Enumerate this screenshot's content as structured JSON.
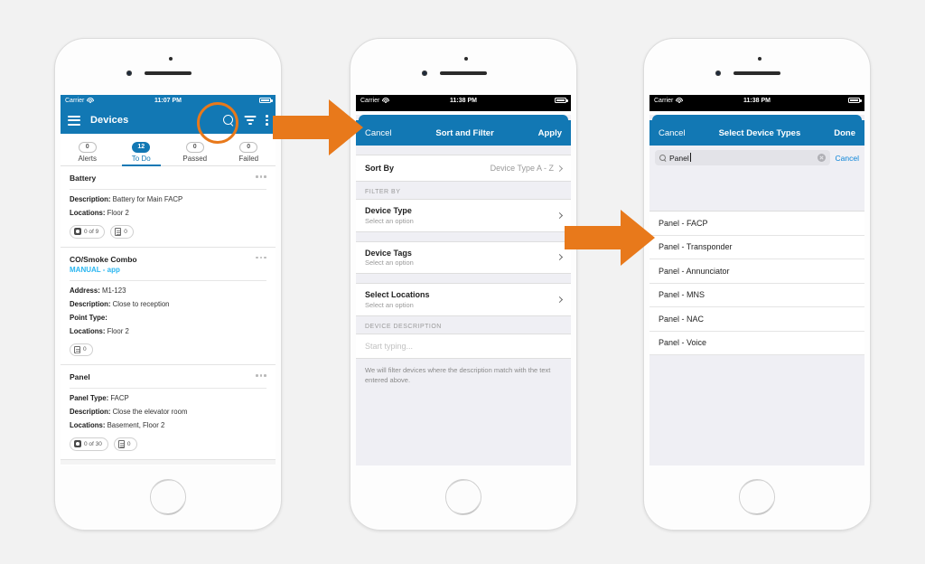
{
  "theme": {
    "brand_blue": "#1278b4",
    "accent_orange": "#e8791b",
    "link_blue": "#0a84d8",
    "cyan": "#29b6f0",
    "page_bg": "#f2f2f2"
  },
  "phone1": {
    "status_bar": {
      "carrier": "Carrier",
      "time": "11:07 PM",
      "wifi_icon": "wifi-icon",
      "battery_icon": "battery-icon"
    },
    "appbar": {
      "menu_icon": "hamburger-menu-icon",
      "title": "Devices",
      "search_icon": "search-icon",
      "filter_icon": "filter-icon",
      "overflow_icon": "kebab-menu-icon"
    },
    "tabs": [
      {
        "count": "0",
        "label": "Alerts",
        "active": false
      },
      {
        "count": "12",
        "label": "To Do",
        "active": true
      },
      {
        "count": "0",
        "label": "Passed",
        "active": false
      },
      {
        "count": "0",
        "label": "Failed",
        "active": false
      }
    ],
    "cards": [
      {
        "title": "Battery",
        "subtitle": "",
        "fields": [
          {
            "key": "Description:",
            "value": " Battery for Main FACP"
          },
          {
            "key": "Locations:",
            "value": " Floor 2"
          }
        ],
        "badges": [
          {
            "icon": "camera-icon",
            "text": "0 of 9"
          },
          {
            "icon": "document-icon",
            "text": "0"
          }
        ]
      },
      {
        "title": "CO/Smoke Combo",
        "subtitle": "MANUAL - app",
        "fields": [
          {
            "key": "Address:",
            "value": " M1-123"
          },
          {
            "key": "Description:",
            "value": " Close to reception"
          },
          {
            "key": "Point Type:",
            "value": ""
          },
          {
            "key": "Locations:",
            "value": " Floor 2"
          }
        ],
        "badges": [
          {
            "icon": "document-icon",
            "text": "0"
          }
        ]
      },
      {
        "title": "Panel",
        "subtitle": "",
        "fields": [
          {
            "key": "Panel Type:",
            "value": " FACP"
          },
          {
            "key": "Description:",
            "value": " Close the elevator room"
          },
          {
            "key": "Locations:",
            "value": " Basement, Floor 2"
          }
        ],
        "badges": [
          {
            "icon": "camera-icon",
            "text": "0 of 30"
          },
          {
            "icon": "document-icon",
            "text": "0"
          }
        ]
      }
    ]
  },
  "phone2": {
    "status_bar": {
      "carrier": "Carrier",
      "time": "11:38 PM",
      "wifi_icon": "wifi-icon",
      "battery_icon": "battery-icon"
    },
    "navbar": {
      "cancel": "Cancel",
      "title": "Sort and Filter",
      "apply": "Apply"
    },
    "sort_by": {
      "label": "Sort By",
      "value": "Device Type A - Z"
    },
    "filter_section_label": "FILTER BY",
    "filter_rows": [
      {
        "title": "Device Type",
        "sub": "Select an option"
      },
      {
        "title": "Device Tags",
        "sub": "Select an option"
      },
      {
        "title": "Select Locations",
        "sub": "Select an option"
      }
    ],
    "description_section_label": "DEVICE DESCRIPTION",
    "description_placeholder": "Start typing...",
    "helper_text": "We will filter devices where the description match with the text entered above."
  },
  "phone3": {
    "status_bar": {
      "carrier": "Carrier",
      "time": "11:38 PM",
      "wifi_icon": "wifi-icon",
      "battery_icon": "battery-icon"
    },
    "navbar": {
      "cancel": "Cancel",
      "title": "Select Device Types",
      "done": "Done"
    },
    "search": {
      "icon": "search-icon",
      "value": "Panel",
      "clear_icon": "clear-circle-icon",
      "cancel": "Cancel"
    },
    "options": [
      "Panel - FACP",
      "Panel - Transponder",
      "Panel - Annunciator",
      "Panel - MNS",
      "Panel - NAC",
      "Panel - Voice"
    ]
  },
  "annotations": {
    "arrow1": "arrow-right-icon",
    "arrow2": "arrow-right-icon",
    "highlight_ring": "highlight-circle"
  }
}
